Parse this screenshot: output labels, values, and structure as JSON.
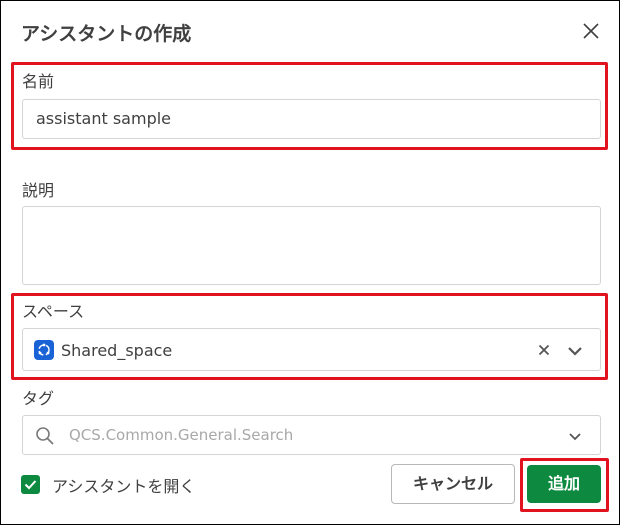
{
  "dialog": {
    "title": "アシスタントの作成",
    "close_icon": "close-icon"
  },
  "name_field": {
    "label": "名前",
    "value": "assistant sample"
  },
  "description_field": {
    "label": "説明",
    "value": ""
  },
  "space_field": {
    "label": "スペース",
    "value": "Shared_space",
    "space_icon": "shared-space-icon",
    "clear_icon": "clear-icon",
    "chevron_icon": "chevron-down-icon"
  },
  "tag_field": {
    "label": "タグ",
    "placeholder": "QCS.Common.General.Search",
    "search_icon": "search-icon",
    "chevron_icon": "chevron-down-icon"
  },
  "open_assistant": {
    "checked": true,
    "label": "アシスタントを開く"
  },
  "buttons": {
    "cancel": "キャンセル",
    "add": "追加"
  },
  "colors": {
    "accent_green": "#0d8a3f",
    "highlight_red": "#e0131f",
    "space_blue": "#1a63d6"
  }
}
